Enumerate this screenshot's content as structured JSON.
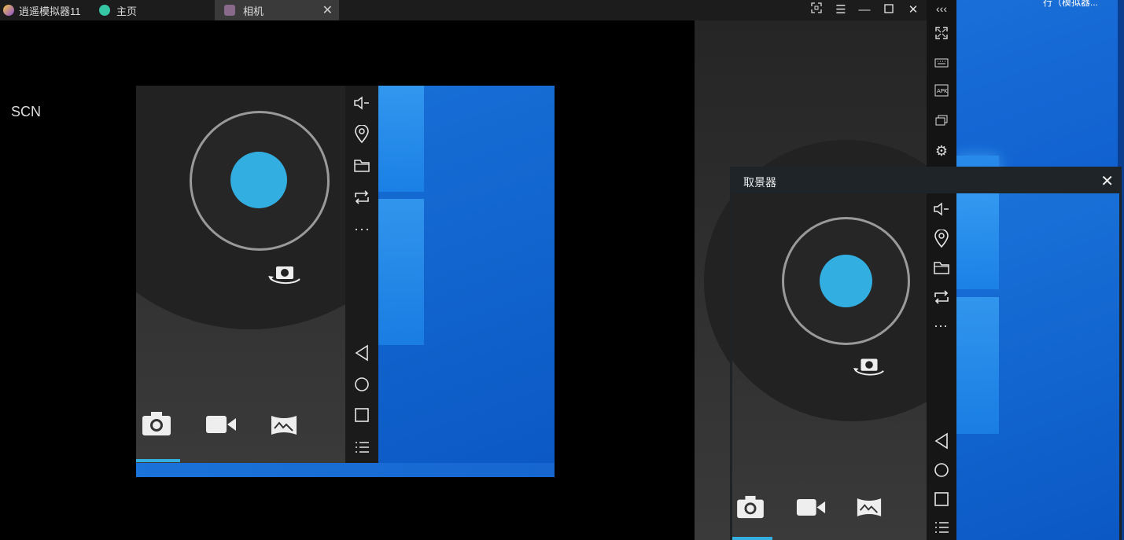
{
  "titlebar": {
    "app_name": "逍遥模拟器11",
    "tabs": [
      {
        "label": "主页"
      },
      {
        "label": "相机"
      }
    ]
  },
  "desktop": {
    "partial_label": "行（模拟器..."
  },
  "left": {
    "scn_label": "SCN"
  },
  "viewfinder": {
    "title": "取景器"
  },
  "colors": {
    "accent": "#33aee0",
    "titlebar_bg": "#1c1c1c",
    "wallpaper": "#0f5fcf"
  },
  "icons": {
    "window_controls": [
      "screenshot-area-icon",
      "menu-icon",
      "minimize-icon",
      "maximize-icon",
      "close-icon"
    ],
    "side_toolbar": [
      "collapse-icon",
      "fullscreen-icon",
      "keyboard-icon",
      "apk-icon",
      "multi-window-icon",
      "settings-icon"
    ],
    "android_tools": [
      "volume-icon",
      "location-icon",
      "folder-icon",
      "rotate-icon",
      "more-icon",
      "back-icon",
      "home-icon",
      "recents-icon",
      "list-icon"
    ],
    "camera_modes": [
      "photo-mode-icon",
      "video-mode-icon",
      "panorama-mode-icon"
    ]
  }
}
